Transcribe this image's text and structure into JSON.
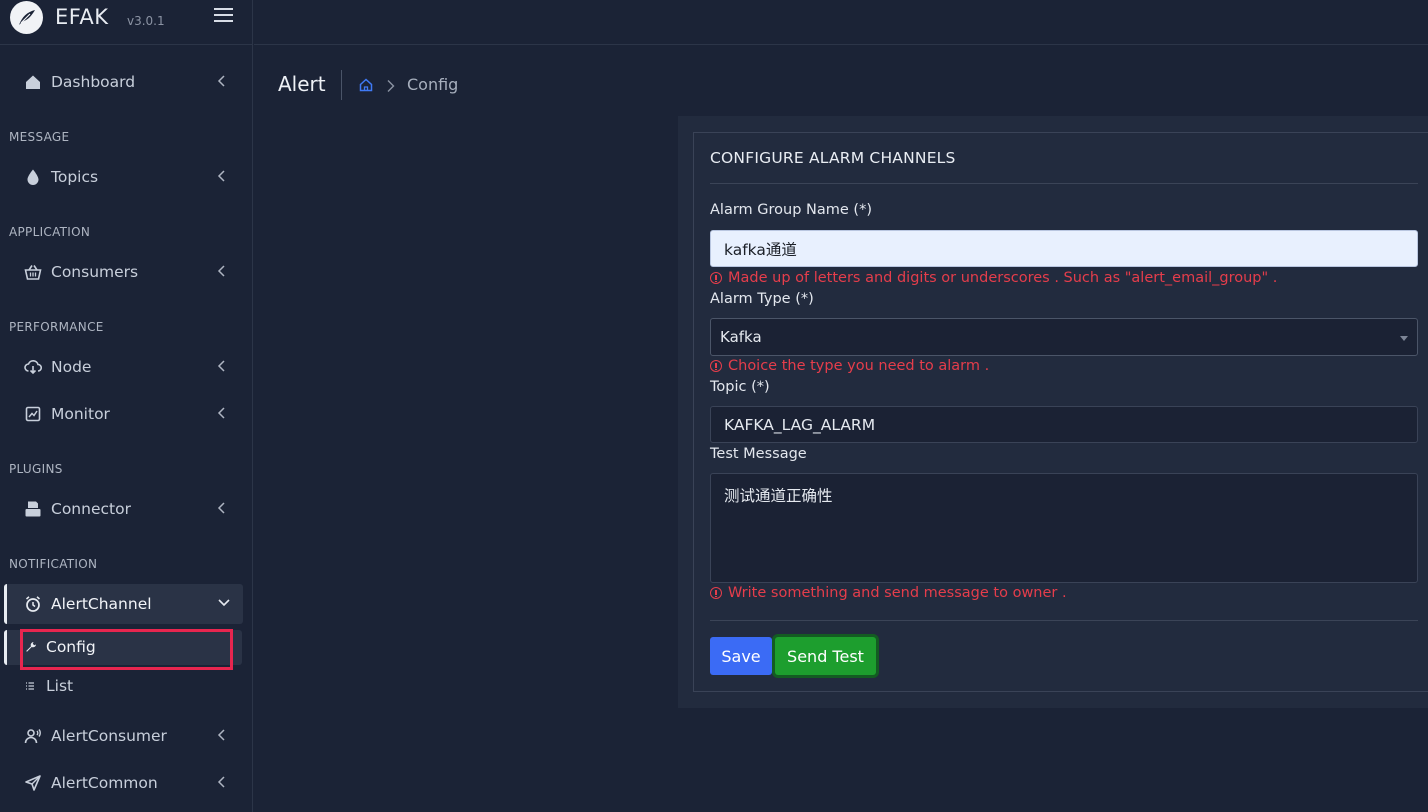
{
  "brand": {
    "name": "EFAK",
    "version": "v3.0.1"
  },
  "sidebar": {
    "sections": {
      "message": "MESSAGE",
      "application": "APPLICATION",
      "performance": "PERFORMANCE",
      "plugins": "PLUGINS",
      "notification": "NOTIFICATION"
    },
    "items": {
      "dashboard": "Dashboard",
      "topics": "Topics",
      "consumers": "Consumers",
      "node": "Node",
      "monitor": "Monitor",
      "connector": "Connector",
      "alertchannel": "AlertChannel",
      "config": "Config",
      "list": "List",
      "alertconsumer": "AlertConsumer",
      "alertcommon": "AlertCommon"
    }
  },
  "header": {
    "title": "Alert",
    "breadcrumb_current": "Config"
  },
  "form": {
    "card_title": "CONFIGURE ALARM CHANNELS",
    "group_name_label": "Alarm Group Name (*)",
    "group_name_value": "kafka通道",
    "group_name_hint": "Made up of letters and digits or underscores . Such as \"alert_email_group\" .",
    "alarm_type_label": "Alarm Type (*)",
    "alarm_type_value": "Kafka",
    "alarm_type_hint": "Choice the type you need to alarm .",
    "topic_label": "Topic (*)",
    "topic_value": "KAFKA_LAG_ALARM",
    "message_label": "Test Message",
    "message_value": "测试通道正确性",
    "message_hint": "Write something and send message to owner .",
    "save_label": "Save",
    "send_test_label": "Send Test"
  },
  "colors": {
    "background": "#1b2336",
    "error": "#e53d4b",
    "save": "#3b6bf5",
    "send_test": "#1d9e2e",
    "highlight": "#e8264f"
  }
}
